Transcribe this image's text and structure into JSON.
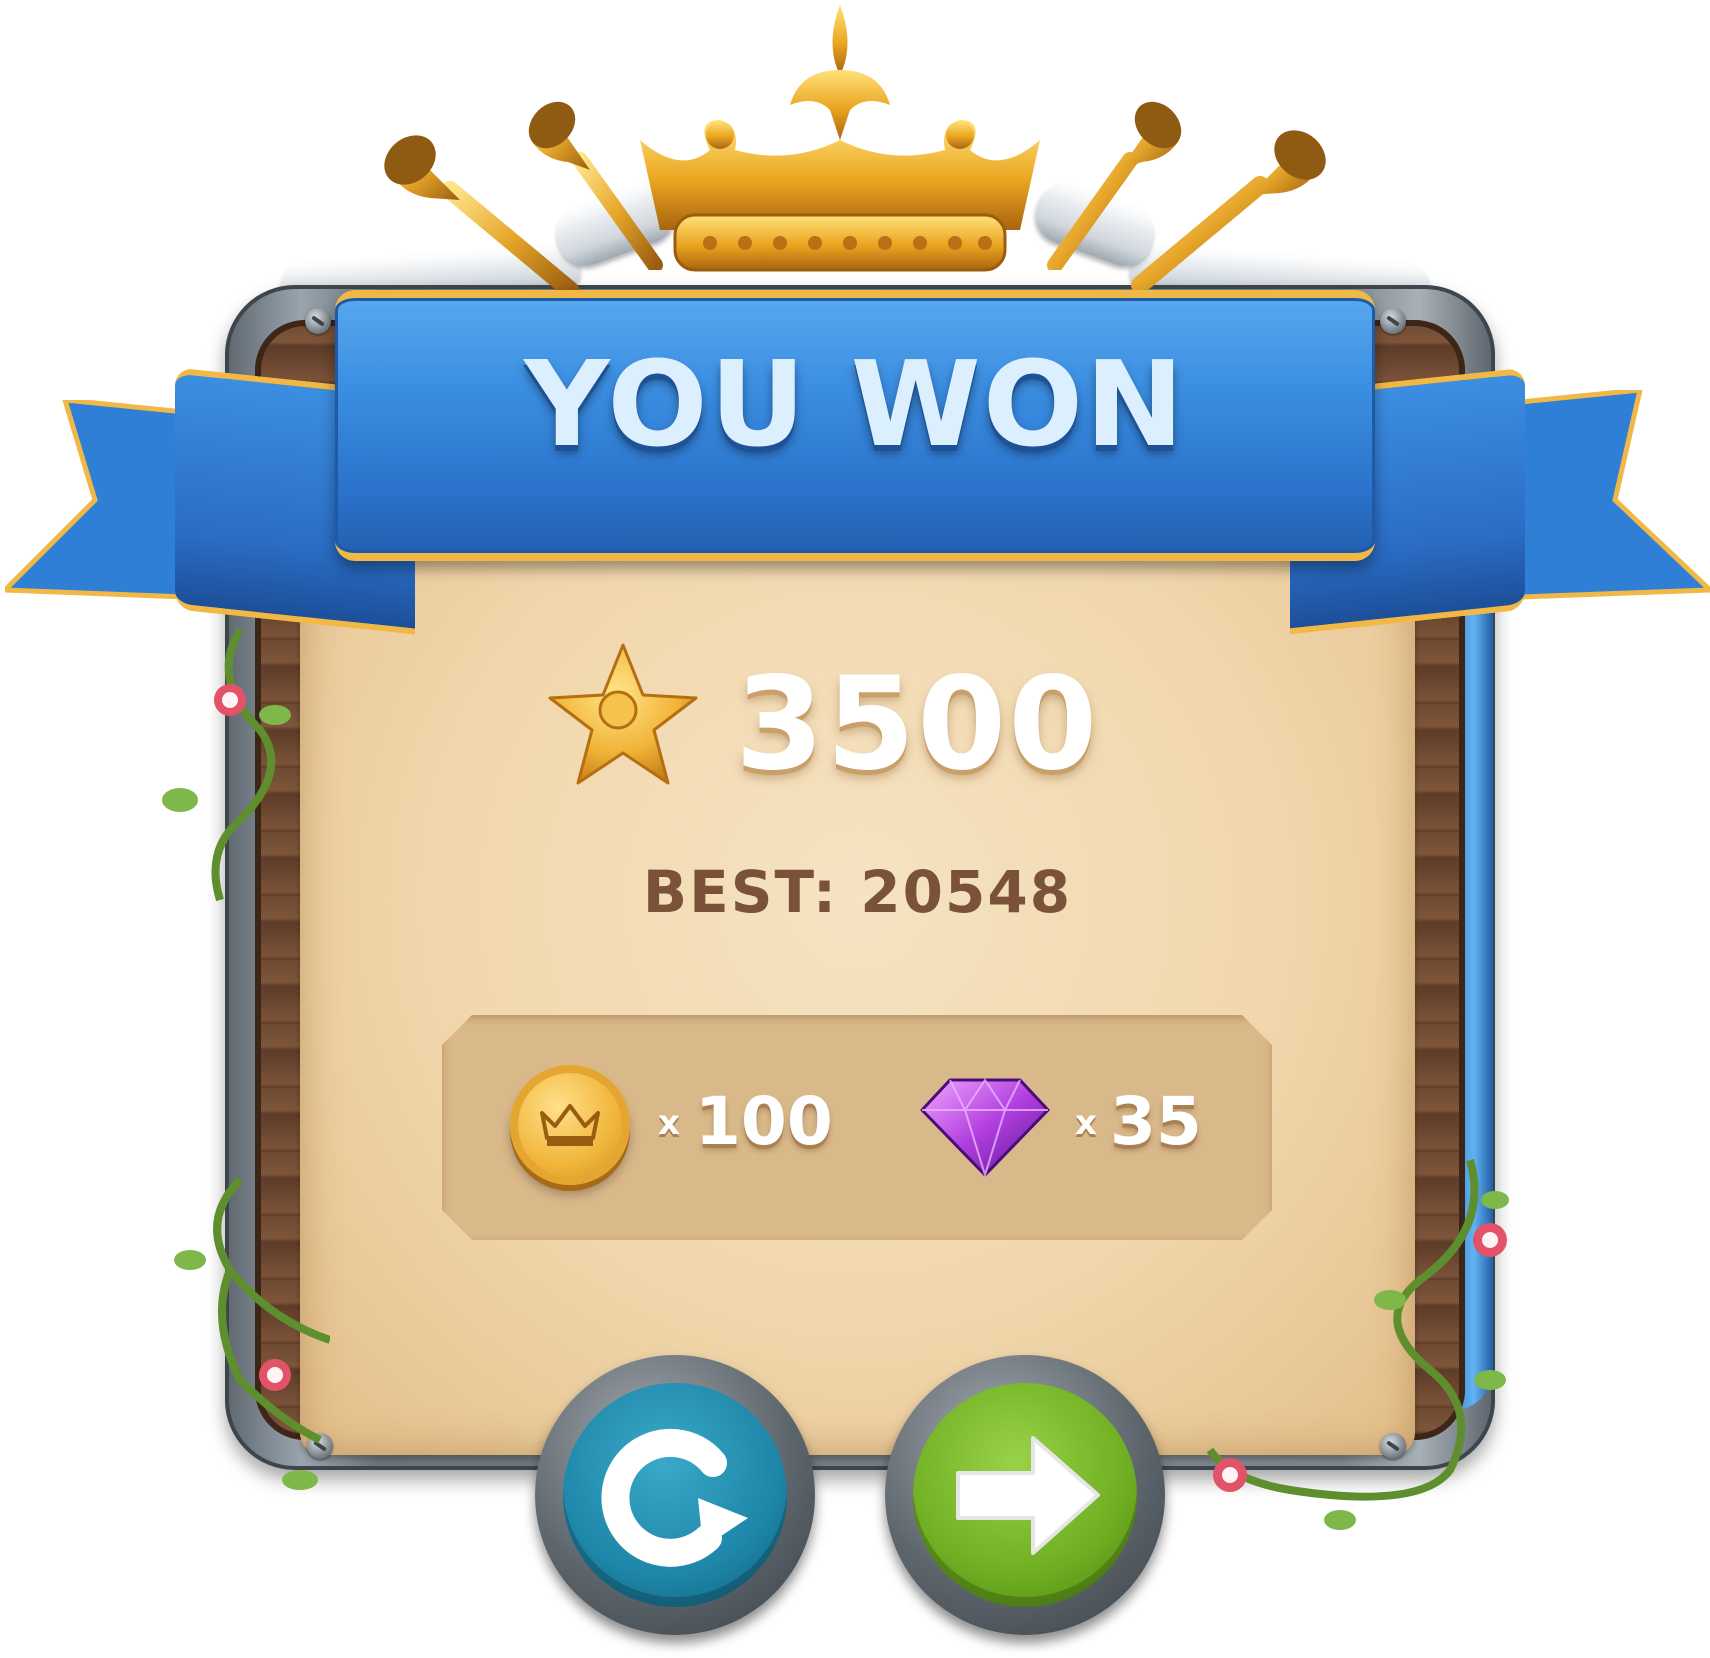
{
  "dialog": {
    "title": "YOU WON",
    "score": "3500",
    "best_label": "BEST: 20548"
  },
  "rewards": [
    {
      "icon": "crown-coin-icon",
      "multiplier": "x",
      "amount": "100"
    },
    {
      "icon": "purple-gem-icon",
      "multiplier": "x",
      "amount": "35"
    }
  ],
  "buttons": {
    "restart": {
      "icon": "restart-icon"
    },
    "next": {
      "icon": "arrow-right-icon"
    }
  },
  "colors": {
    "ribbon": "#3b8ee2",
    "ribbon_trim": "#f0b847",
    "parchment": "#f0d6ab",
    "best_text": "#7a5239",
    "restart_button": "#1e86a8",
    "next_button": "#6fae22"
  }
}
